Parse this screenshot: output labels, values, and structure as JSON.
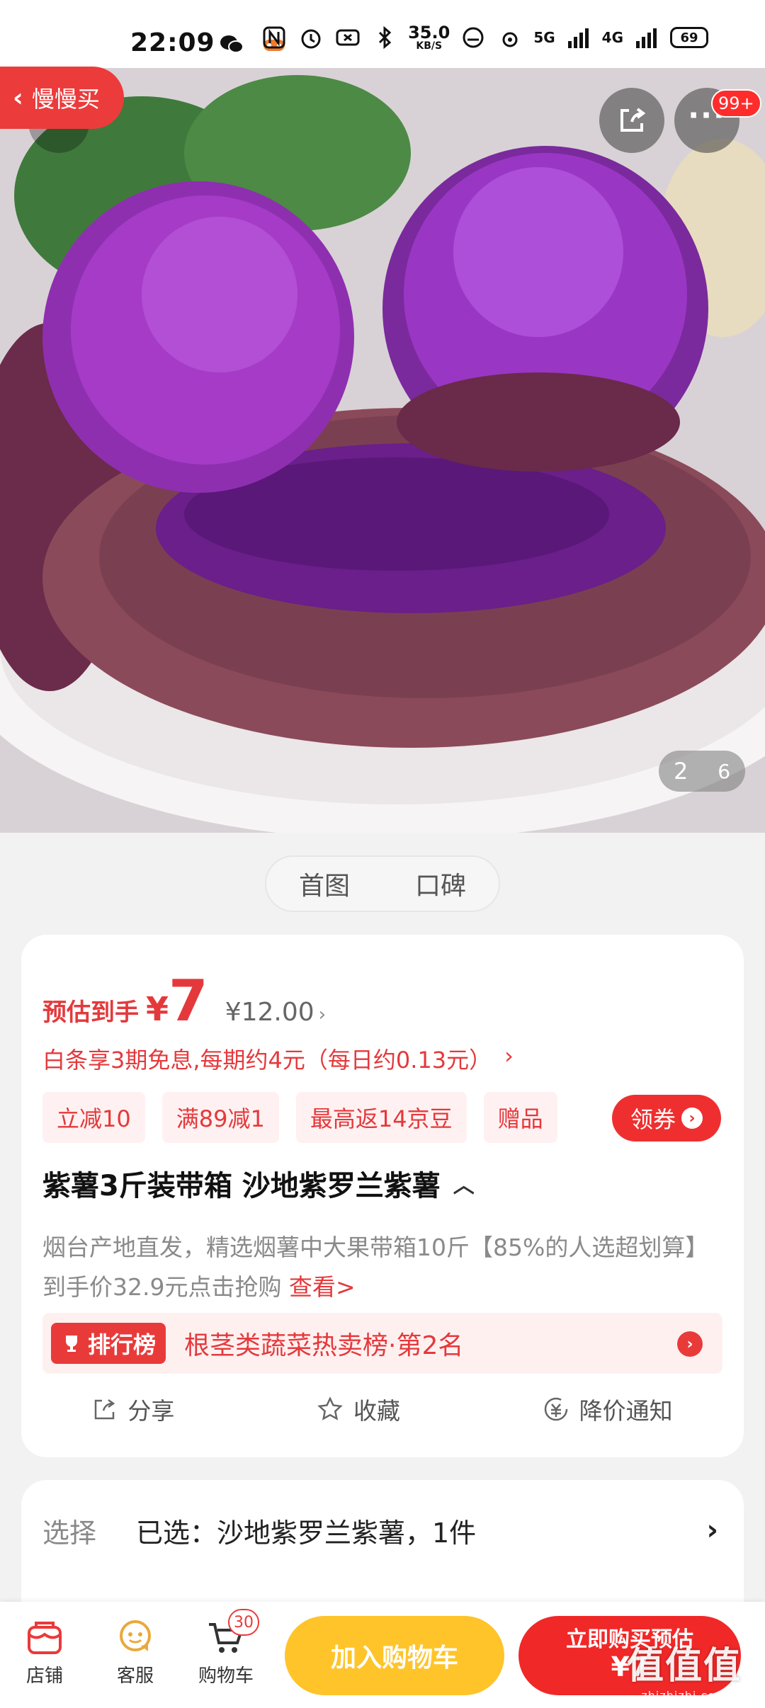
{
  "status_bar": {
    "time": "22:09",
    "net_speed_value": "35.0",
    "net_speed_unit": "KB/S",
    "signal_1": "5G",
    "signal_2": "4G",
    "battery": "69"
  },
  "header": {
    "back_label": "慢慢买",
    "notification_badge": "99+"
  },
  "gallery": {
    "current_index": "2",
    "total": "6"
  },
  "segmented": {
    "tabs": [
      "首图",
      "口碑"
    ]
  },
  "price": {
    "label": "预估到手",
    "currency": "¥",
    "estimate": "7",
    "original": "¥12.00",
    "arrow": "›"
  },
  "installment": {
    "text": "白条享3期免息,每期约4元（每日约0.13元）",
    "arrow": "›"
  },
  "promo_tags": [
    "立减10",
    "满89减1",
    "最高返14京豆",
    "赠品"
  ],
  "coupon_button": "领券",
  "product": {
    "title": "紫薯3斤装带箱 沙地紫罗兰紫薯",
    "description": "烟台产地直发，精选烟薯中大果带箱10斤【85%的人选超划算】到手价32.9元点击抢购",
    "description_more": "查看>"
  },
  "ranking": {
    "badge": "排行榜",
    "text": "根茎类蔬菜热卖榜·第2名"
  },
  "actions": {
    "share": "分享",
    "favorite": "收藏",
    "price_alert": "降价通知"
  },
  "selection": {
    "label": "选择",
    "value": "已选：沙地紫罗兰紫薯，1件"
  },
  "bottom_nav": {
    "shop": "店铺",
    "service": "客服",
    "cart": "购物车",
    "cart_count": "30",
    "add_to_cart": "加入购物车",
    "buy_now": "立即购买预估",
    "buy_price": "¥7"
  },
  "watermark": {
    "logo": "值值值",
    "site": "zhizhizhi.com"
  },
  "colors": {
    "accent_red": "#e4393c",
    "cart_yellow": "#ffc42a",
    "buy_red": "#f12828"
  }
}
